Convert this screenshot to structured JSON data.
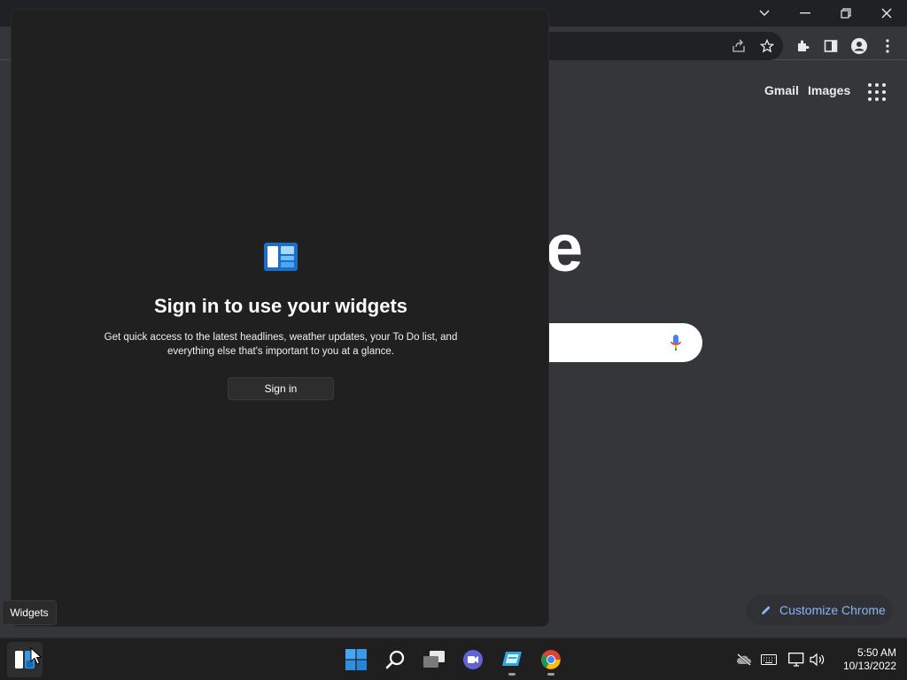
{
  "chrome": {
    "links": {
      "gmail": "Gmail",
      "images": "Images"
    },
    "logo_fragment": "e",
    "customize_label": "Customize Chrome"
  },
  "widgets": {
    "title": "Sign in to use your widgets",
    "description_line1": "Get quick access to the latest headlines, weather updates, your To Do list, and",
    "description_line2": "everything else that's important to you at a glance.",
    "signin_label": "Sign in",
    "tooltip": "Widgets"
  },
  "taskbar": {
    "apps": [
      "widgets-icon",
      "windows-start-icon",
      "search-icon",
      "task-view-icon",
      "teams-chat-icon",
      "app-icon",
      "chrome-icon"
    ],
    "time": "5:50 AM",
    "date": "10/13/2022"
  },
  "colors": {
    "accent": "#8ab4f8",
    "panel_bg": "#202020",
    "taskbar_bg": "#1f1f1f",
    "chrome_bg": "#35363a"
  }
}
